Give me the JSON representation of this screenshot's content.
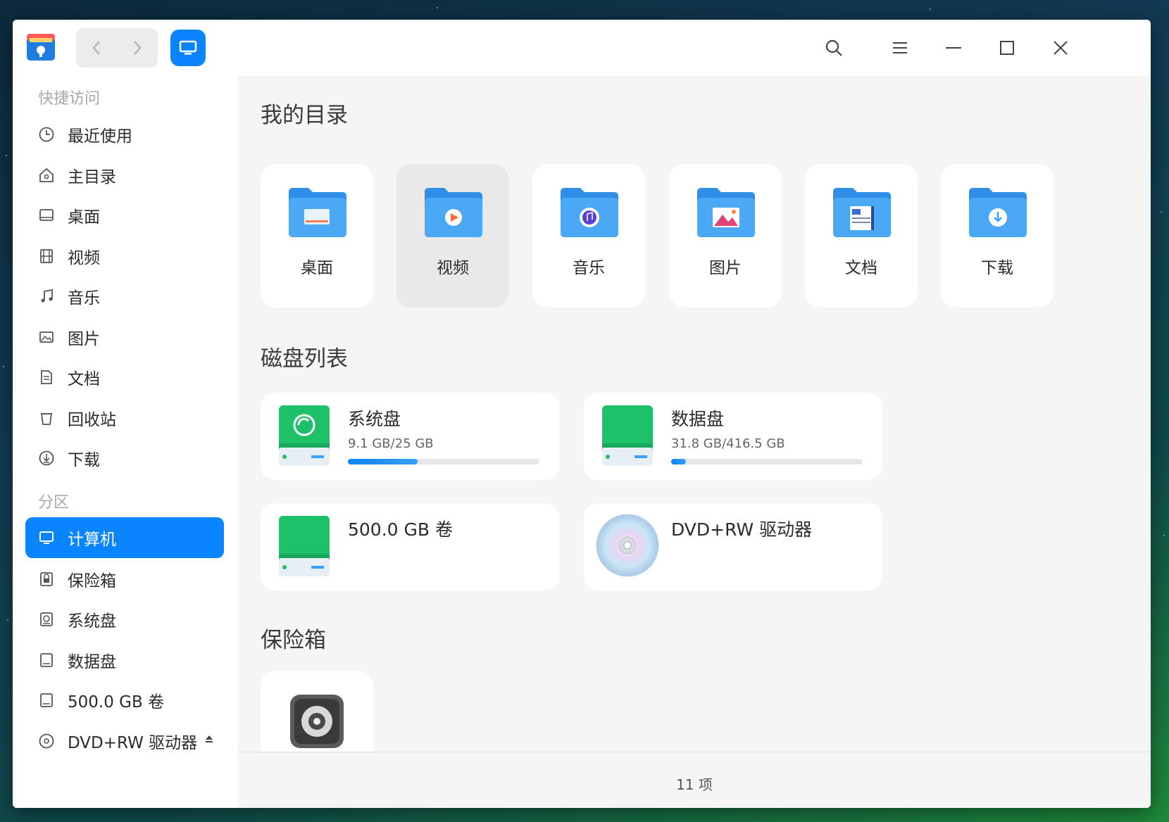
{
  "window": {
    "title_icon": "file-manager-icon",
    "accent": "#0a84ff"
  },
  "toolbar": {
    "back_icon": "chevron-left-icon",
    "forward_icon": "chevron-right-icon",
    "view_icon": "computer-icon",
    "search_icon": "search-icon",
    "menu_icon": "menu-icon",
    "minimize_icon": "minimize-icon",
    "maximize_icon": "maximize-icon",
    "close_icon": "close-icon"
  },
  "sidebar": {
    "quick_access_title": "快捷访问",
    "quick_items": [
      {
        "label": "最近使用",
        "icon": "clock-icon"
      },
      {
        "label": "主目录",
        "icon": "home-icon"
      },
      {
        "label": "桌面",
        "icon": "desktop-icon"
      },
      {
        "label": "视频",
        "icon": "film-icon"
      },
      {
        "label": "音乐",
        "icon": "music-icon"
      },
      {
        "label": "图片",
        "icon": "image-icon"
      },
      {
        "label": "文档",
        "icon": "document-icon"
      },
      {
        "label": "回收站",
        "icon": "trash-icon"
      },
      {
        "label": "下载",
        "icon": "download-icon"
      }
    ],
    "partition_title": "分区",
    "partition_items": [
      {
        "label": "计算机",
        "icon": "computer-icon",
        "active": true
      },
      {
        "label": "保险箱",
        "icon": "vault-icon"
      },
      {
        "label": "系统盘",
        "icon": "system-disk-icon"
      },
      {
        "label": "数据盘",
        "icon": "disk-icon"
      },
      {
        "label": "500.0 GB 卷",
        "icon": "disk-icon"
      },
      {
        "label": "DVD+RW 驱动器",
        "icon": "optical-disc-icon",
        "eject_icon": "eject-icon"
      }
    ]
  },
  "main": {
    "my_dirs_title": "我的目录",
    "folders": [
      {
        "label": "桌面",
        "icon": "desktop-folder-icon"
      },
      {
        "label": "视频",
        "icon": "video-folder-icon"
      },
      {
        "label": "音乐",
        "icon": "music-folder-icon"
      },
      {
        "label": "图片",
        "icon": "pictures-folder-icon"
      },
      {
        "label": "文档",
        "icon": "documents-folder-icon"
      },
      {
        "label": "下载",
        "icon": "downloads-folder-icon"
      }
    ],
    "disks_title": "磁盘列表",
    "disks": [
      {
        "name": "系统盘",
        "size": "9.1 GB/25 GB",
        "usage": 0.364,
        "icon": "system-disk-icon"
      },
      {
        "name": "数据盘",
        "size": "31.8 GB/416.5 GB",
        "usage": 0.076,
        "icon": "data-disk-icon"
      },
      {
        "name": "500.0 GB 卷",
        "icon": "volume-disk-icon"
      },
      {
        "name": "DVD+RW 驱动器",
        "icon": "optical-disc-icon"
      }
    ],
    "vault_title": "保险箱",
    "vault_icon": "safe-icon"
  },
  "status": {
    "item_count": "11 项"
  }
}
